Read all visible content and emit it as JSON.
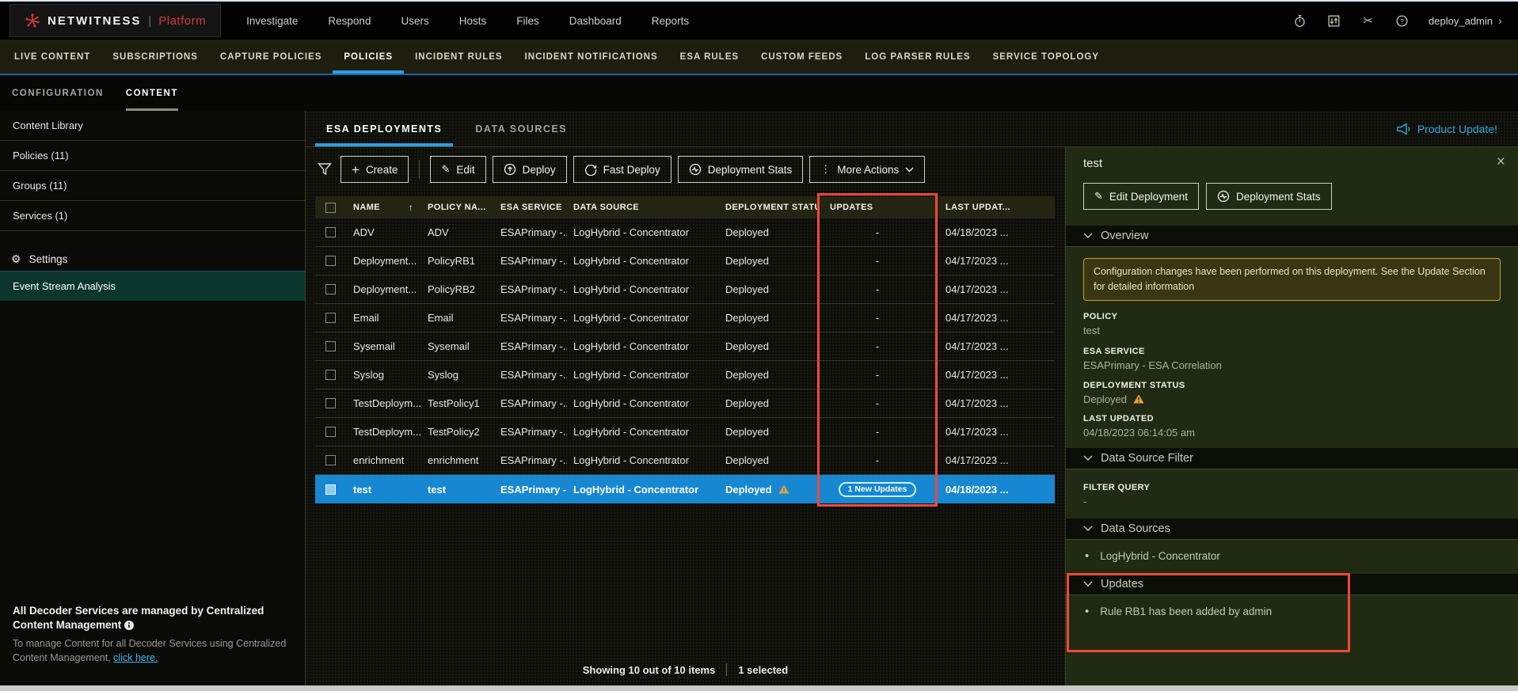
{
  "colors": {
    "accent_blue": "#2D9FE0",
    "selection_blue": "#1787D2",
    "annotation_red": "#F3473B",
    "warning_amber": "#E8A33D",
    "link_cyan": "#2FA9DE",
    "brand_red": "#D6392F"
  },
  "topbar": {
    "brand_name": "NETWITNESS",
    "brand_divider": "|",
    "brand_product": "Platform",
    "menus": [
      "Investigate",
      "Respond",
      "Users",
      "Hosts",
      "Files",
      "Dashboard",
      "Reports"
    ],
    "user": "deploy_admin",
    "user_chevron": "›"
  },
  "nav2": {
    "items": [
      "LIVE CONTENT",
      "SUBSCRIPTIONS",
      "CAPTURE POLICIES",
      "POLICIES",
      "INCIDENT RULES",
      "INCIDENT NOTIFICATIONS",
      "ESA RULES",
      "CUSTOM FEEDS",
      "LOG PARSER RULES",
      "SERVICE TOPOLOGY"
    ],
    "active": "POLICIES"
  },
  "nav3": {
    "items": [
      "CONFIGURATION",
      "CONTENT"
    ],
    "active": "CONTENT"
  },
  "sidebar": {
    "items": [
      "Content Library",
      "Policies (11)",
      "Groups (11)",
      "Services (1)"
    ],
    "settings": "Settings",
    "selected": "Event Stream Analysis",
    "footer_title": "All Decoder Services are managed by Centralized Content Management",
    "footer_text": "To manage Content for all Decoder Services using Centralized Content Management, ",
    "footer_link": "click here."
  },
  "main": {
    "tabs": [
      "ESA DEPLOYMENTS",
      "DATA SOURCES"
    ],
    "active_tab": "ESA DEPLOYMENTS",
    "product_update": "Product Update!",
    "toolbar": {
      "create": "Create",
      "edit": "Edit",
      "deploy": "Deploy",
      "fast_deploy": "Fast Deploy",
      "stats": "Deployment Stats",
      "more": "More Actions"
    },
    "table": {
      "headers": {
        "name": "NAME",
        "sort": "↑",
        "policy": "POLICY NA...",
        "service": "ESA SERVICE",
        "source": "DATA SOURCE",
        "status": "DEPLOYMENT STATUS",
        "updates": "UPDATES",
        "updated": "LAST UPDAT..."
      },
      "rows": [
        {
          "name": "ADV",
          "policy": "ADV",
          "service": "ESAPrimary -...",
          "source": "LogHybrid - Concentrator",
          "status": "Deployed",
          "updates": "-",
          "updated": "04/18/2023 ..."
        },
        {
          "name": "Deployment...",
          "policy": "PolicyRB1",
          "service": "ESAPrimary -...",
          "source": "LogHybrid - Concentrator",
          "status": "Deployed",
          "updates": "-",
          "updated": "04/17/2023 ..."
        },
        {
          "name": "Deployment...",
          "policy": "PolicyRB2",
          "service": "ESAPrimary -...",
          "source": "LogHybrid - Concentrator",
          "status": "Deployed",
          "updates": "-",
          "updated": "04/17/2023 ..."
        },
        {
          "name": "Email",
          "policy": "Email",
          "service": "ESAPrimary -...",
          "source": "LogHybrid - Concentrator",
          "status": "Deployed",
          "updates": "-",
          "updated": "04/17/2023 ..."
        },
        {
          "name": "Sysemail",
          "policy": "Sysemail",
          "service": "ESAPrimary -...",
          "source": "LogHybrid - Concentrator",
          "status": "Deployed",
          "updates": "-",
          "updated": "04/17/2023 ..."
        },
        {
          "name": "Syslog",
          "policy": "Syslog",
          "service": "ESAPrimary -...",
          "source": "LogHybrid - Concentrator",
          "status": "Deployed",
          "updates": "-",
          "updated": "04/17/2023 ..."
        },
        {
          "name": "TestDeploym...",
          "policy": "TestPolicy1",
          "service": "ESAPrimary -...",
          "source": "LogHybrid - Concentrator",
          "status": "Deployed",
          "updates": "-",
          "updated": "04/17/2023 ..."
        },
        {
          "name": "TestDeploym...",
          "policy": "TestPolicy2",
          "service": "ESAPrimary -...",
          "source": "LogHybrid - Concentrator",
          "status": "Deployed",
          "updates": "-",
          "updated": "04/17/2023 ..."
        },
        {
          "name": "enrichment",
          "policy": "enrichment",
          "service": "ESAPrimary -...",
          "source": "LogHybrid - Concentrator",
          "status": "Deployed",
          "updates": "-",
          "updated": "04/17/2023 ..."
        },
        {
          "name": "test",
          "policy": "test",
          "service": "ESAPrimary -...",
          "source": "LogHybrid - Concentrator",
          "status": "Deployed",
          "updates": "1 New Updates",
          "updated": "04/18/2023 ..."
        }
      ]
    },
    "badge": "1 New Updates",
    "status_showing": "Showing 10 out of 10 items",
    "status_selected": "1 selected"
  },
  "panel": {
    "title": "test",
    "close": "×",
    "edit_button": "Edit Deployment",
    "stats_button": "Deployment Stats",
    "overview": "Overview",
    "warning": "Configuration changes have been performed on this deployment. See the Update Section for detailed information",
    "policy_label": "POLICY",
    "policy_value": "test",
    "service_label": "ESA SERVICE",
    "service_value": "ESAPrimary - ESA Correlation",
    "status_label": "DEPLOYMENT STATUS",
    "status_value": "Deployed",
    "updated_label": "LAST UPDATED",
    "updated_value": "04/18/2023 06:14:05 am",
    "dsf": "Data Source Filter",
    "filter_label": "FILTER QUERY",
    "filter_value": "-",
    "ds": "Data Sources",
    "ds_item": "LogHybrid - Concentrator",
    "updates": "Updates",
    "updates_item": "Rule RB1 has been added by admin"
  }
}
